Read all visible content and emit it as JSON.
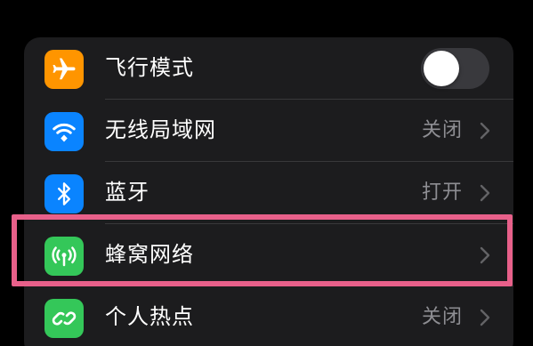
{
  "settings": {
    "rows": [
      {
        "label": "飞行模式",
        "value": "",
        "icon": "airplane-icon",
        "icon_color": "#ff9500",
        "control": "toggle",
        "toggle_on": false
      },
      {
        "label": "无线局域网",
        "value": "关闭",
        "icon": "wifi-icon",
        "icon_color": "#0a84ff",
        "control": "chevron"
      },
      {
        "label": "蓝牙",
        "value": "打开",
        "icon": "bluetooth-icon",
        "icon_color": "#0a84ff",
        "control": "chevron"
      },
      {
        "label": "蜂窝网络",
        "value": "",
        "icon": "cellular-antenna-icon",
        "icon_color": "#34c759",
        "control": "chevron"
      },
      {
        "label": "个人热点",
        "value": "关闭",
        "icon": "personal-hotspot-icon",
        "icon_color": "#34c759",
        "control": "chevron"
      }
    ],
    "highlight_color": "#e8608a"
  }
}
